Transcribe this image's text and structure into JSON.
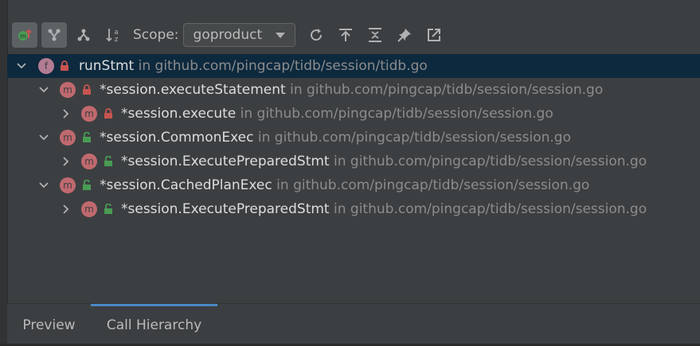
{
  "toolbar": {
    "buttons": [
      {
        "icon": "caller-hierarchy-icon",
        "active": true
      },
      {
        "icon": "merge-hierarchy-icon",
        "active": true
      },
      {
        "icon": "callee-hierarchy-icon",
        "active": false
      },
      {
        "icon": "sort-alphabetically-icon",
        "active": false
      }
    ],
    "scope_label": "Scope:",
    "scope_value": "goproduct",
    "actions": [
      "refresh-icon",
      "expand-to-top-icon",
      "expand-all-icon",
      "pin-icon",
      "open-in-new-icon"
    ]
  },
  "tree": {
    "rows": [
      {
        "name": "runStmt",
        "in": "in",
        "location": "github.com/pingcap/tidb/session/tidb.go",
        "kind": "f",
        "access": "private",
        "expanded": true
      },
      {
        "name": "*session.executeStatement",
        "in": "in",
        "location": "github.com/pingcap/tidb/session/session.go",
        "kind": "m",
        "access": "private",
        "expanded": true
      },
      {
        "name": "*session.execute",
        "in": "in",
        "location": "github.com/pingcap/tidb/session/session.go",
        "kind": "m",
        "access": "private",
        "expanded": false
      },
      {
        "name": "*session.CommonExec",
        "in": "in",
        "location": "github.com/pingcap/tidb/session/session.go",
        "kind": "m",
        "access": "public",
        "expanded": true
      },
      {
        "name": "*session.ExecutePreparedStmt",
        "in": "in",
        "location": "github.com/pingcap/tidb/session/session.go",
        "kind": "m",
        "access": "public",
        "expanded": false
      },
      {
        "name": "*session.CachedPlanExec",
        "in": "in",
        "location": "github.com/pingcap/tidb/session/session.go",
        "kind": "m",
        "access": "public",
        "expanded": true
      },
      {
        "name": "*session.ExecutePreparedStmt",
        "in": "in",
        "location": "github.com/pingcap/tidb/session/session.go",
        "kind": "m",
        "access": "public",
        "expanded": false
      }
    ]
  },
  "tabs": [
    {
      "label": "Preview",
      "active": false
    },
    {
      "label": "Call Hierarchy",
      "active": true
    }
  ],
  "colors": {
    "background": "#3c3f41",
    "selected_row": "#0d293e",
    "function_badge": "#b27c93",
    "method_badge": "#c0696f",
    "private_lock": "#c75450",
    "public_lock": "#499c54",
    "active_tab": "#4a88c7"
  }
}
